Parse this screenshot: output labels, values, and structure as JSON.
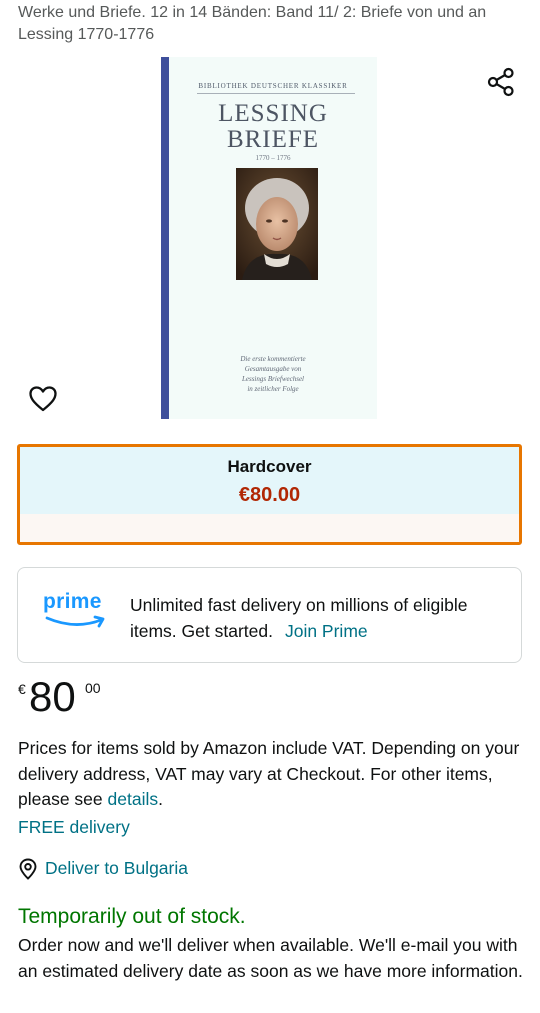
{
  "product": {
    "title": "Werke und Briefe. 12 in 14 Bänden: Band 11/ 2: Briefe von und an Lessing 1770-1776"
  },
  "cover": {
    "series": "Bibliothek Deutscher Klassiker",
    "author": "LESSING",
    "work": "BRIEFE",
    "years": "1770 – 1776",
    "blurb": [
      "Die erste kommentierte",
      "Gesamtausgabe von",
      "Lessings Briefwechsel",
      "in zeitlicher Folge"
    ],
    "colors": {
      "background": "#f3fbf9",
      "spine": "#3e4f9b"
    }
  },
  "icons": {
    "share": "share-icon",
    "wishlist": "heart-icon",
    "location": "location-pin-icon"
  },
  "format": {
    "name": "Hardcover",
    "price": "€80.00",
    "colors": {
      "border": "#e77600",
      "top_bg": "#e4f6fa",
      "bottom_bg": "#fcf7f3",
      "price": "#b12704"
    }
  },
  "prime": {
    "logo_text": "prime",
    "message": "Unlimited fast delivery on millions of eligible items. Get started.",
    "link": "Join Prime",
    "colors": {
      "logo": "#1a98ff"
    }
  },
  "price": {
    "symbol": "€",
    "whole": "80",
    "fraction": "00"
  },
  "vat": {
    "text": "Prices for items sold by Amazon include VAT. Depending on your delivery address, VAT may vary at Checkout. For other items, please see",
    "link": "details",
    "suffix": "."
  },
  "delivery": {
    "free": "FREE delivery",
    "deliver_to": "Deliver to Bulgaria"
  },
  "stock": {
    "status": "Temporarily out of stock.",
    "note": "Order now and we'll deliver when available. We'll e-mail you with an estimated delivery date as soon as we have more information.",
    "color": "#007600"
  },
  "colors": {
    "link": "#007185",
    "text": "#0f1111"
  }
}
